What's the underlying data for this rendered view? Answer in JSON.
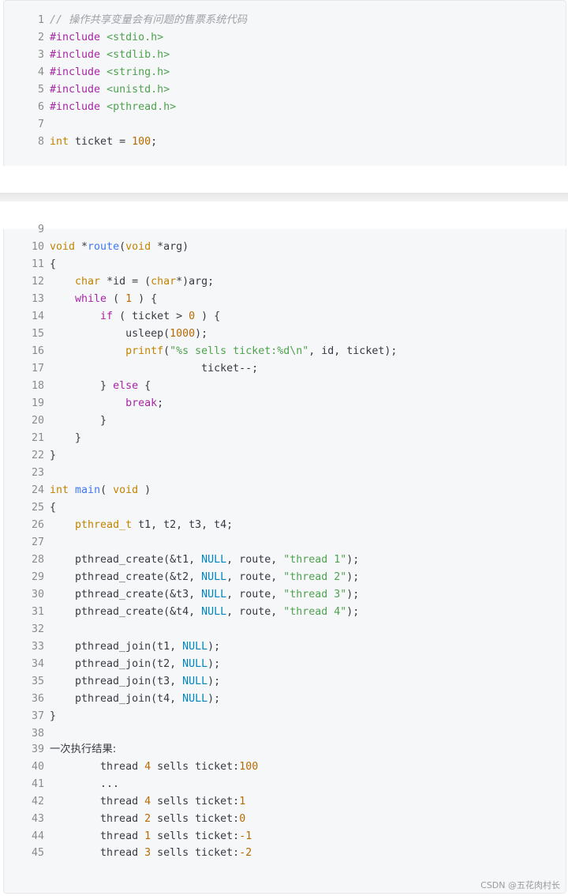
{
  "lines": [
    {
      "n": "1",
      "t": [
        {
          "s": "// 操作共享变量会有问题的售票系统代码",
          "c": "c"
        }
      ]
    },
    {
      "n": "2",
      "t": [
        {
          "s": "#include",
          "c": "kw"
        },
        {
          "s": " "
        },
        {
          "s": "<stdio.h>",
          "c": "str"
        }
      ]
    },
    {
      "n": "3",
      "t": [
        {
          "s": "#include",
          "c": "kw"
        },
        {
          "s": " "
        },
        {
          "s": "<stdlib.h>",
          "c": "str"
        }
      ]
    },
    {
      "n": "4",
      "t": [
        {
          "s": "#include",
          "c": "kw"
        },
        {
          "s": " "
        },
        {
          "s": "<string.h>",
          "c": "str"
        }
      ]
    },
    {
      "n": "5",
      "t": [
        {
          "s": "#include",
          "c": "kw"
        },
        {
          "s": " "
        },
        {
          "s": "<unistd.h>",
          "c": "str"
        }
      ]
    },
    {
      "n": "6",
      "t": [
        {
          "s": "#include",
          "c": "kw"
        },
        {
          "s": " "
        },
        {
          "s": "<pthread.h>",
          "c": "str"
        }
      ]
    },
    {
      "n": "7",
      "t": []
    },
    {
      "n": "8",
      "t": [
        {
          "s": "int",
          "c": "ty"
        },
        {
          "s": " ticket = "
        },
        {
          "s": "100",
          "c": "num"
        },
        {
          "s": ";"
        }
      ]
    },
    {
      "n": "9",
      "t": []
    },
    {
      "n": "10",
      "t": [
        {
          "s": "void",
          "c": "ty"
        },
        {
          "s": " *"
        },
        {
          "s": "route",
          "c": "fn"
        },
        {
          "s": "("
        },
        {
          "s": "void",
          "c": "ty"
        },
        {
          "s": " *arg)"
        }
      ]
    },
    {
      "n": "11",
      "t": [
        {
          "s": "{"
        }
      ]
    },
    {
      "n": "12",
      "t": [
        {
          "s": "    "
        },
        {
          "s": "char",
          "c": "ty"
        },
        {
          "s": " *id = ("
        },
        {
          "s": "char",
          "c": "ty"
        },
        {
          "s": "*)arg;"
        }
      ]
    },
    {
      "n": "13",
      "t": [
        {
          "s": "    "
        },
        {
          "s": "while",
          "c": "kw"
        },
        {
          "s": " ( "
        },
        {
          "s": "1",
          "c": "num"
        },
        {
          "s": " ) {"
        }
      ]
    },
    {
      "n": "14",
      "t": [
        {
          "s": "        "
        },
        {
          "s": "if",
          "c": "kw"
        },
        {
          "s": " ( ticket > "
        },
        {
          "s": "0",
          "c": "num"
        },
        {
          "s": " ) {"
        }
      ]
    },
    {
      "n": "15",
      "t": [
        {
          "s": "            usleep("
        },
        {
          "s": "1000",
          "c": "num"
        },
        {
          "s": ");"
        }
      ]
    },
    {
      "n": "16",
      "t": [
        {
          "s": "            "
        },
        {
          "s": "printf",
          "c": "ty"
        },
        {
          "s": "("
        },
        {
          "s": "\"%s sells ticket:%d\\n\"",
          "c": "str"
        },
        {
          "s": ", id, ticket);"
        }
      ]
    },
    {
      "n": "17",
      "t": [
        {
          "s": "                        ticket--;"
        }
      ]
    },
    {
      "n": "18",
      "t": [
        {
          "s": "        } "
        },
        {
          "s": "else",
          "c": "kw"
        },
        {
          "s": " {"
        }
      ]
    },
    {
      "n": "19",
      "t": [
        {
          "s": "            "
        },
        {
          "s": "break",
          "c": "kw"
        },
        {
          "s": ";"
        }
      ]
    },
    {
      "n": "20",
      "t": [
        {
          "s": "        }"
        }
      ]
    },
    {
      "n": "21",
      "t": [
        {
          "s": "    }"
        }
      ]
    },
    {
      "n": "22",
      "t": [
        {
          "s": "}"
        }
      ]
    },
    {
      "n": "23",
      "t": []
    },
    {
      "n": "24",
      "t": [
        {
          "s": "int",
          "c": "ty"
        },
        {
          "s": " "
        },
        {
          "s": "main",
          "c": "fn"
        },
        {
          "s": "( "
        },
        {
          "s": "void",
          "c": "ty"
        },
        {
          "s": " )"
        }
      ]
    },
    {
      "n": "25",
      "t": [
        {
          "s": "{"
        }
      ]
    },
    {
      "n": "26",
      "t": [
        {
          "s": "    "
        },
        {
          "s": "pthread_t",
          "c": "ty"
        },
        {
          "s": " t1, t2, t3, t4;"
        }
      ]
    },
    {
      "n": "27",
      "t": []
    },
    {
      "n": "28",
      "t": [
        {
          "s": "    pthread_create(&t1, "
        },
        {
          "s": "NULL",
          "c": "nl"
        },
        {
          "s": ", route, "
        },
        {
          "s": "\"thread 1\"",
          "c": "str"
        },
        {
          "s": ");"
        }
      ]
    },
    {
      "n": "29",
      "t": [
        {
          "s": "    pthread_create(&t2, "
        },
        {
          "s": "NULL",
          "c": "nl"
        },
        {
          "s": ", route, "
        },
        {
          "s": "\"thread 2\"",
          "c": "str"
        },
        {
          "s": ");"
        }
      ]
    },
    {
      "n": "30",
      "t": [
        {
          "s": "    pthread_create(&t3, "
        },
        {
          "s": "NULL",
          "c": "nl"
        },
        {
          "s": ", route, "
        },
        {
          "s": "\"thread 3\"",
          "c": "str"
        },
        {
          "s": ");"
        }
      ]
    },
    {
      "n": "31",
      "t": [
        {
          "s": "    pthread_create(&t4, "
        },
        {
          "s": "NULL",
          "c": "nl"
        },
        {
          "s": ", route, "
        },
        {
          "s": "\"thread 4\"",
          "c": "str"
        },
        {
          "s": ");"
        }
      ]
    },
    {
      "n": "32",
      "t": []
    },
    {
      "n": "33",
      "t": [
        {
          "s": "    pthread_join(t1, "
        },
        {
          "s": "NULL",
          "c": "nl"
        },
        {
          "s": ");"
        }
      ]
    },
    {
      "n": "34",
      "t": [
        {
          "s": "    pthread_join(t2, "
        },
        {
          "s": "NULL",
          "c": "nl"
        },
        {
          "s": ");"
        }
      ]
    },
    {
      "n": "35",
      "t": [
        {
          "s": "    pthread_join(t3, "
        },
        {
          "s": "NULL",
          "c": "nl"
        },
        {
          "s": ");"
        }
      ]
    },
    {
      "n": "36",
      "t": [
        {
          "s": "    pthread_join(t4, "
        },
        {
          "s": "NULL",
          "c": "nl"
        },
        {
          "s": ");"
        }
      ]
    },
    {
      "n": "37",
      "t": [
        {
          "s": "}"
        }
      ]
    },
    {
      "n": "38",
      "t": []
    },
    {
      "n": "39",
      "t": [
        {
          "s": "一次执行结果:",
          "c": "cjk"
        }
      ]
    },
    {
      "n": "40",
      "t": [
        {
          "s": "        thread "
        },
        {
          "s": "4",
          "c": "num"
        },
        {
          "s": " sells ticket:"
        },
        {
          "s": "100",
          "c": "num"
        }
      ]
    },
    {
      "n": "41",
      "t": [
        {
          "s": "        ..."
        }
      ]
    },
    {
      "n": "42",
      "t": [
        {
          "s": "        thread "
        },
        {
          "s": "4",
          "c": "num"
        },
        {
          "s": " sells ticket:"
        },
        {
          "s": "1",
          "c": "num"
        }
      ]
    },
    {
      "n": "43",
      "t": [
        {
          "s": "        thread "
        },
        {
          "s": "2",
          "c": "num"
        },
        {
          "s": " sells ticket:"
        },
        {
          "s": "0",
          "c": "num"
        }
      ]
    },
    {
      "n": "44",
      "t": [
        {
          "s": "        thread "
        },
        {
          "s": "1",
          "c": "num"
        },
        {
          "s": " sells ticket:"
        },
        {
          "s": "-1",
          "c": "num"
        }
      ]
    },
    {
      "n": "45",
      "t": [
        {
          "s": "        thread "
        },
        {
          "s": "3",
          "c": "num"
        },
        {
          "s": " sells ticket:"
        },
        {
          "s": "-2",
          "c": "num"
        }
      ]
    }
  ],
  "watermark": "CSDN @五花肉村长"
}
